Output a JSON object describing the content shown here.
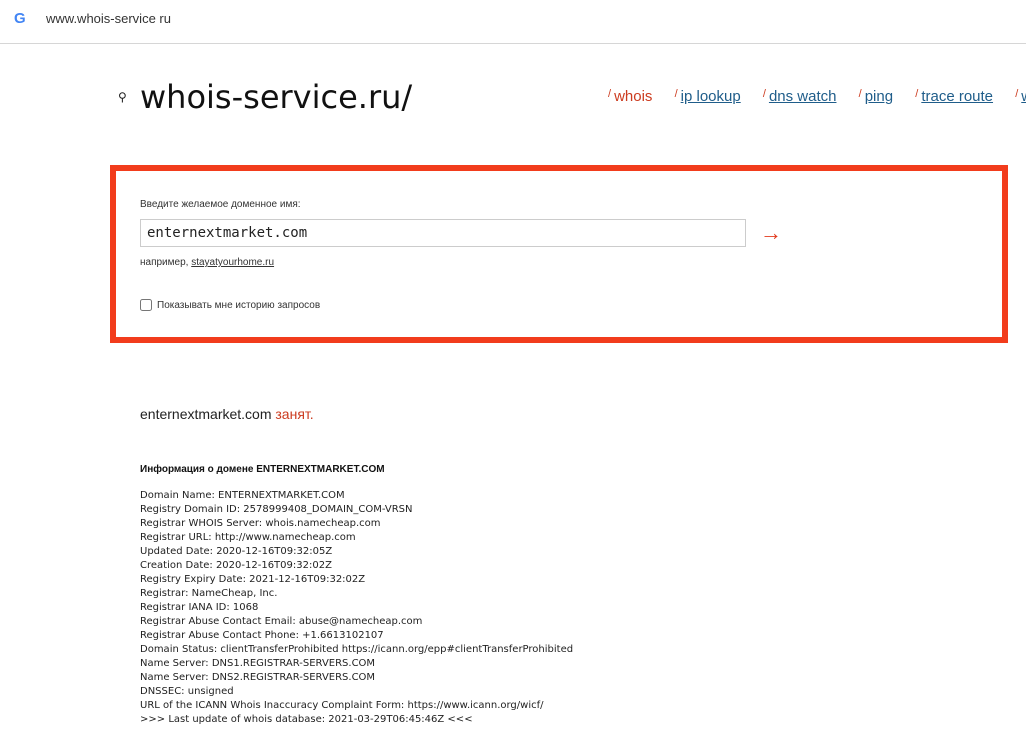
{
  "browser": {
    "icon": "google-g-icon",
    "url": "www.whois-service ru"
  },
  "header": {
    "logo_icon": "key-icon",
    "logo_text": "whois-service.ru/",
    "nav": [
      {
        "label": "whois",
        "active": true
      },
      {
        "label": "ip lookup",
        "active": false
      },
      {
        "label": "dns watch",
        "active": false
      },
      {
        "label": "ping",
        "active": false
      },
      {
        "label": "trace route",
        "active": false
      },
      {
        "label": "wh",
        "active": false
      }
    ],
    "nav_tick": "/"
  },
  "search": {
    "label": "Введите желаемое доменное имя:",
    "value": "enternextmarket.com",
    "submit_glyph": "→",
    "example_prefix": "например,",
    "example_link": "stayatyourhome.ru",
    "history_label": "Показывать мне историю запросов",
    "history_checked": false
  },
  "result": {
    "domain": "enternextmarket.com",
    "status": "занят."
  },
  "info": {
    "title": "Информация о домене ENTERNEXTMARKET.COM",
    "lines": [
      "Domain Name: ENTERNEXTMARKET.COM",
      "Registry Domain ID: 2578999408_DOMAIN_COM-VRSN",
      "Registrar WHOIS Server: whois.namecheap.com",
      "Registrar URL: http://www.namecheap.com",
      "Updated Date: 2020-12-16T09:32:05Z",
      "Creation Date: 2020-12-16T09:32:02Z",
      "Registry Expiry Date: 2021-12-16T09:32:02Z",
      "Registrar: NameCheap, Inc.",
      "Registrar IANA ID: 1068",
      "Registrar Abuse Contact Email: abuse@namecheap.com",
      "Registrar Abuse Contact Phone: +1.6613102107",
      "Domain Status: clientTransferProhibited https://icann.org/epp#clientTransferProhibited",
      "Name Server: DNS1.REGISTRAR-SERVERS.COM",
      "Name Server: DNS2.REGISTRAR-SERVERS.COM",
      "DNSSEC: unsigned",
      "URL of the ICANN Whois Inaccuracy Complaint Form: https://www.icann.org/wicf/",
      ">>> Last update of whois database: 2021-03-29T06:45:46Z <<<"
    ]
  },
  "colors": {
    "accent": "#f23c1c",
    "link": "#1f5d8a",
    "status": "#cc3b1f"
  }
}
